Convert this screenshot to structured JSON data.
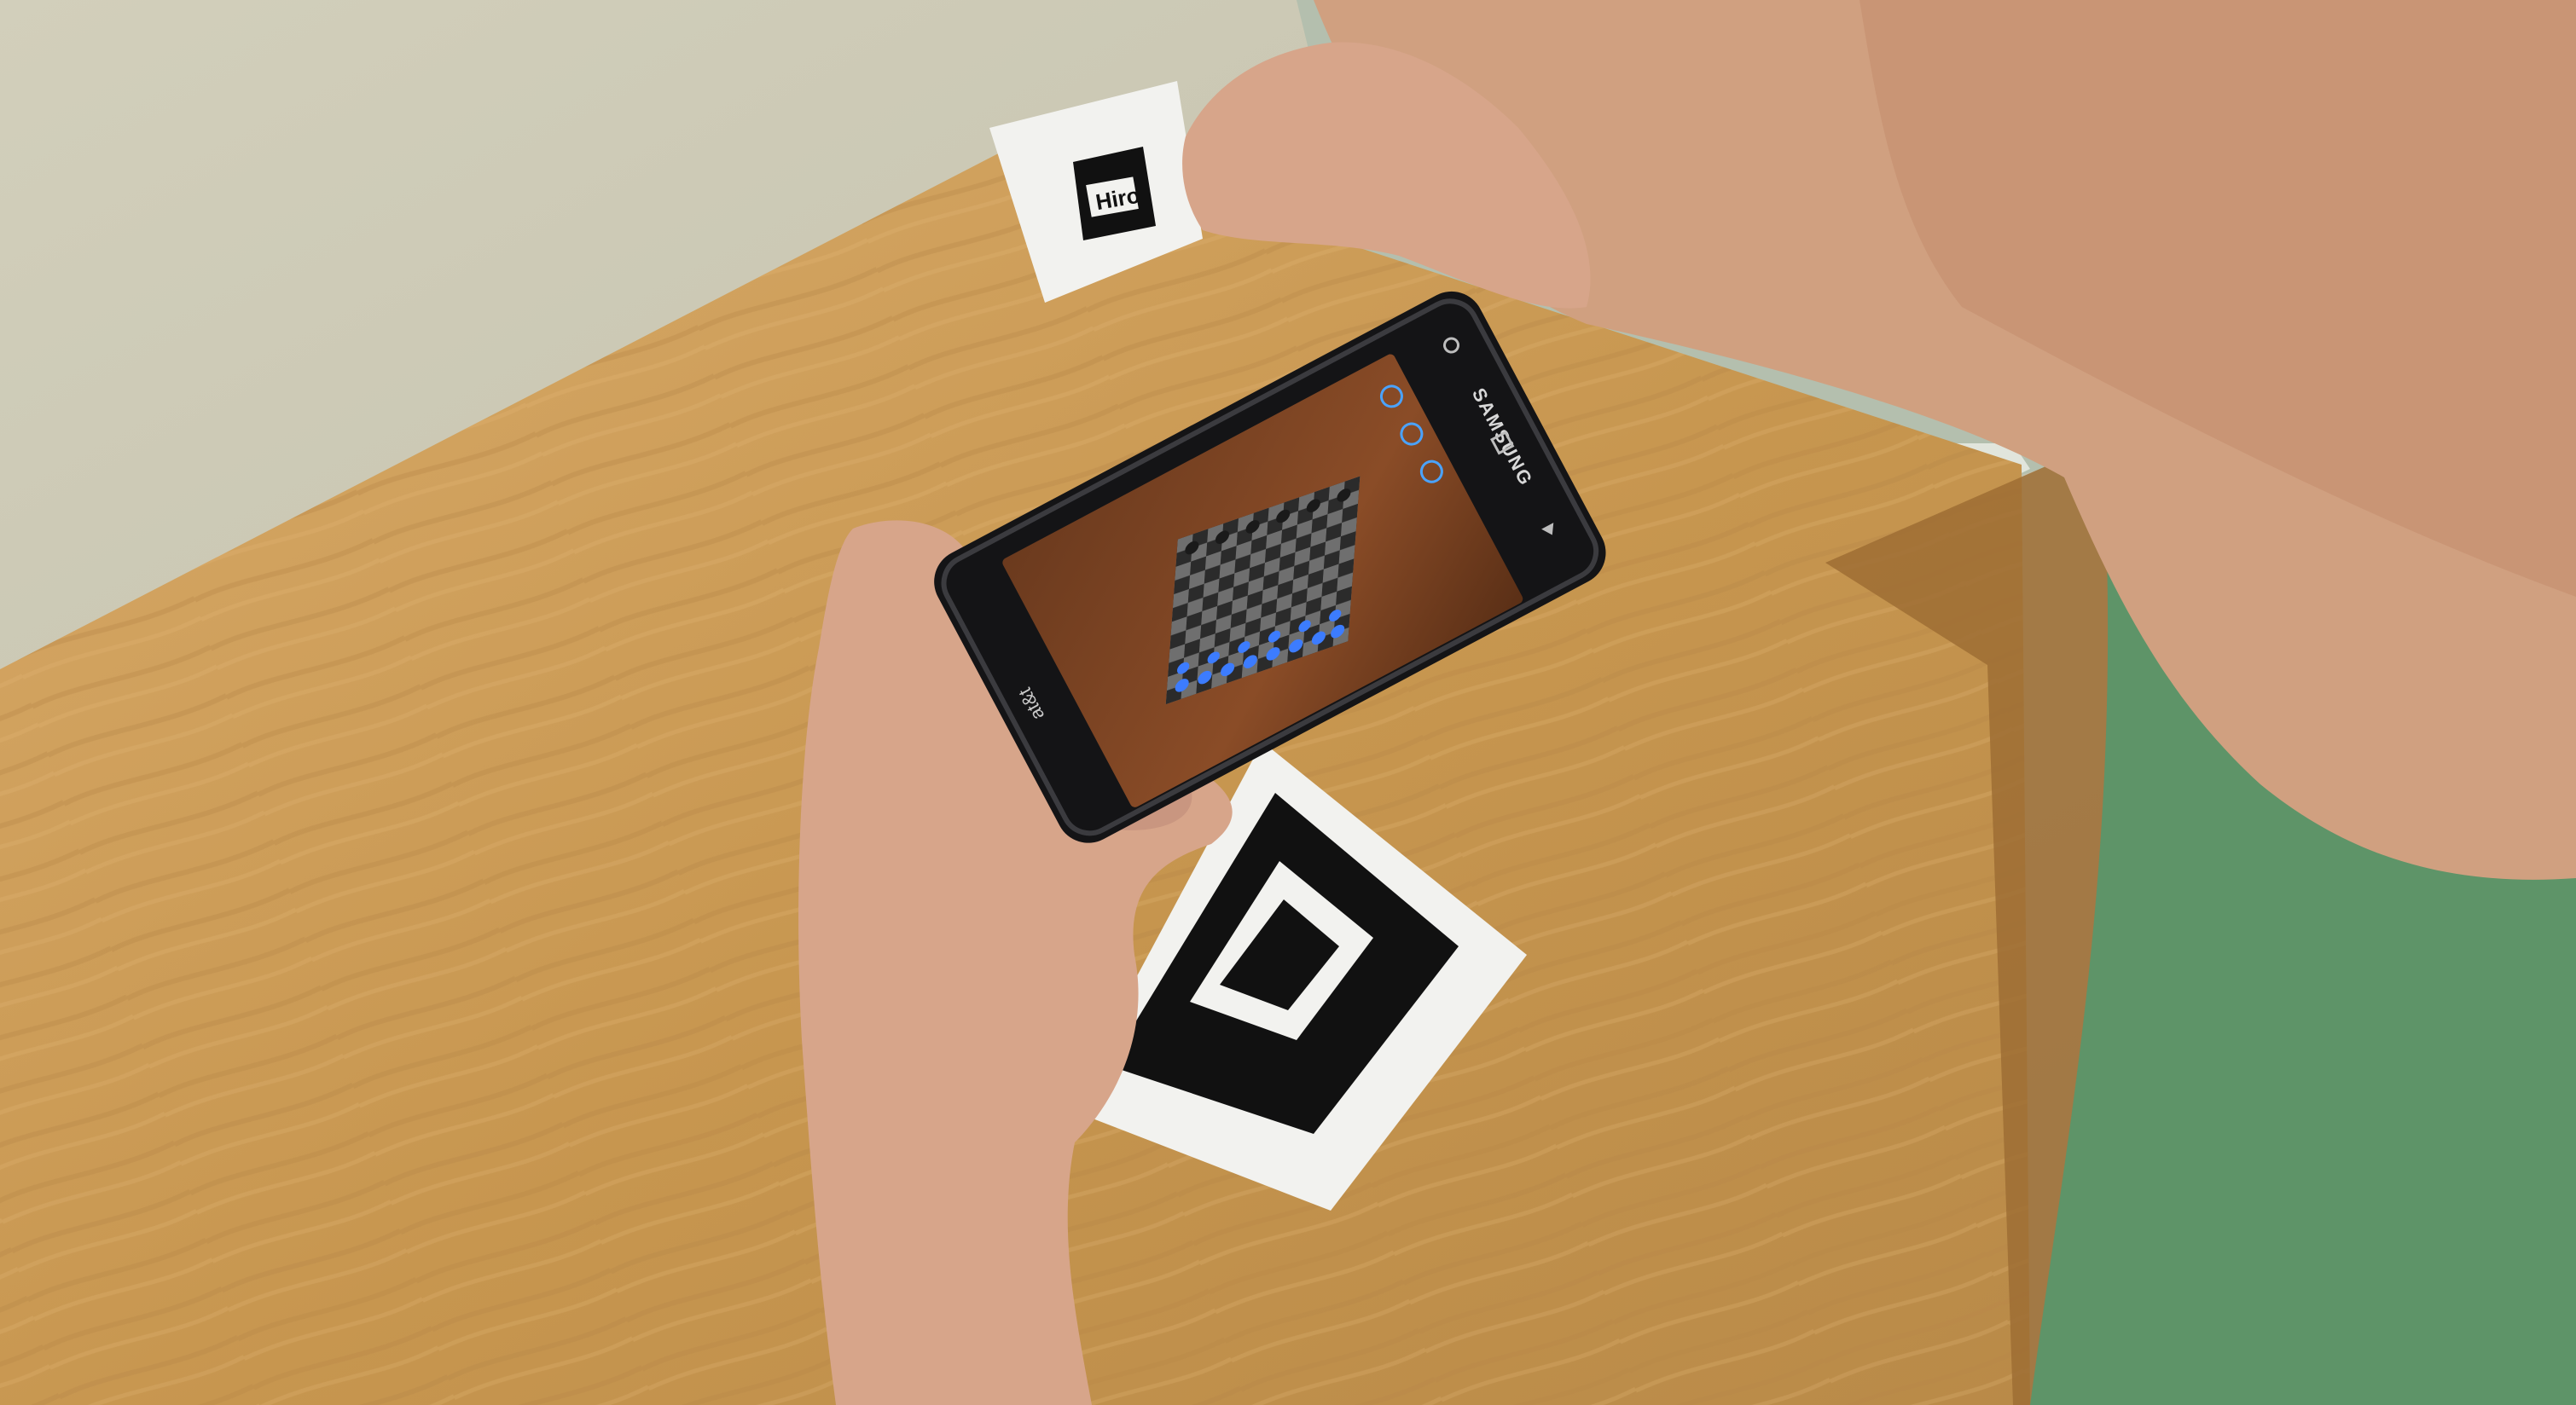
{
  "scene": {
    "description_free": true,
    "colors": {
      "wall": "#c9c6b2",
      "wall_shadow": "#a9a794",
      "table": "#c99b5c",
      "table_dark": "#a97a3f",
      "shirt": "#5e9468",
      "skin": "#d7a58a",
      "phone_body": "#141416",
      "marker_paper": "#f2f2ef",
      "marker_black": "#111111",
      "ar_piece": "#3c7cff"
    }
  },
  "marker_small": {
    "label": "Hiro"
  },
  "phone": {
    "carrier_logo": "at&t",
    "brand_logo": "SAMSUNG"
  }
}
